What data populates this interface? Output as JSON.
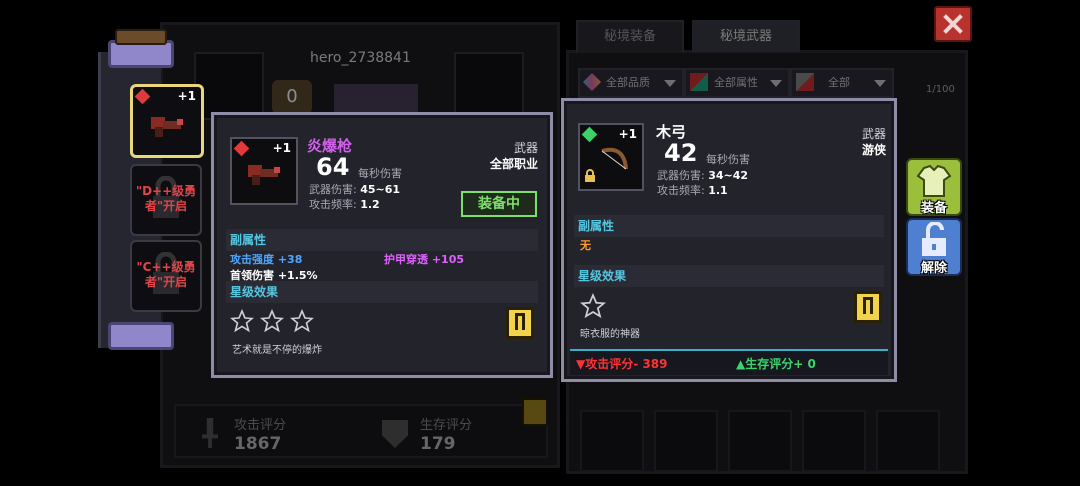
{
  "colors": {
    "rarity_purple": "#d060e8",
    "equipped_green": "#7ee06a",
    "stat_blue": "#4fa6ff",
    "stat_pink": "#e060ff",
    "section_cyan": "#55c6e0",
    "orange": "#ff9a2a",
    "red": "#ff3333",
    "green": "#3ad46c"
  },
  "bg": {
    "player_name": "hero_2738841",
    "level_badge": "0",
    "attack_score_label": "攻击评分",
    "attack_score_value": "1867",
    "survival_score_label": "生存评分",
    "survival_score_value": "179",
    "tabs": [
      {
        "label": "秘境装备"
      },
      {
        "label": "秘境武器"
      }
    ],
    "filters": [
      {
        "label": "全部品质"
      },
      {
        "label": "全部属性"
      },
      {
        "label": "全部"
      }
    ],
    "capacity": "1/100"
  },
  "slots": [
    {
      "plus": "+1"
    },
    {
      "lock_text": "\"D++级勇者\"开启"
    },
    {
      "lock_text": "\"C++级勇者\"开启"
    }
  ],
  "equipped_card": {
    "name": "炎爆枪",
    "plus": "+1",
    "dps": "64",
    "dps_label": "每秒伤害",
    "damage_label": "武器伤害:",
    "damage_value": "45~61",
    "rate_label": "攻击频率:",
    "rate_value": "1.2",
    "type": "武器",
    "class": "全部职业",
    "equipped_badge": "装备中",
    "sub_attr_title": "副属性",
    "attrs": [
      {
        "label": "攻击强度",
        "value": "+38"
      },
      {
        "label": "护甲穿透",
        "value": "+105"
      },
      {
        "label": "首领伤害",
        "value": "+1.5%"
      }
    ],
    "star_title": "星级效果",
    "stars": 3,
    "flavor": "艺术就是不停的爆炸"
  },
  "compare_card": {
    "name": "木弓",
    "plus": "+1",
    "dps": "42",
    "dps_label": "每秒伤害",
    "damage_label": "武器伤害:",
    "damage_value": "34~42",
    "rate_label": "攻击频率:",
    "rate_value": "1.1",
    "type": "武器",
    "class": "游侠",
    "sub_attr_title": "副属性",
    "sub_attr_none": "无",
    "star_title": "星级效果",
    "stars": 1,
    "flavor": "晾衣服的神器",
    "attack_diff": "▼攻击评分- 389",
    "survival_diff": "▲生存评分+ 0"
  },
  "actions": {
    "equip": "装备",
    "unequip": "解除"
  }
}
